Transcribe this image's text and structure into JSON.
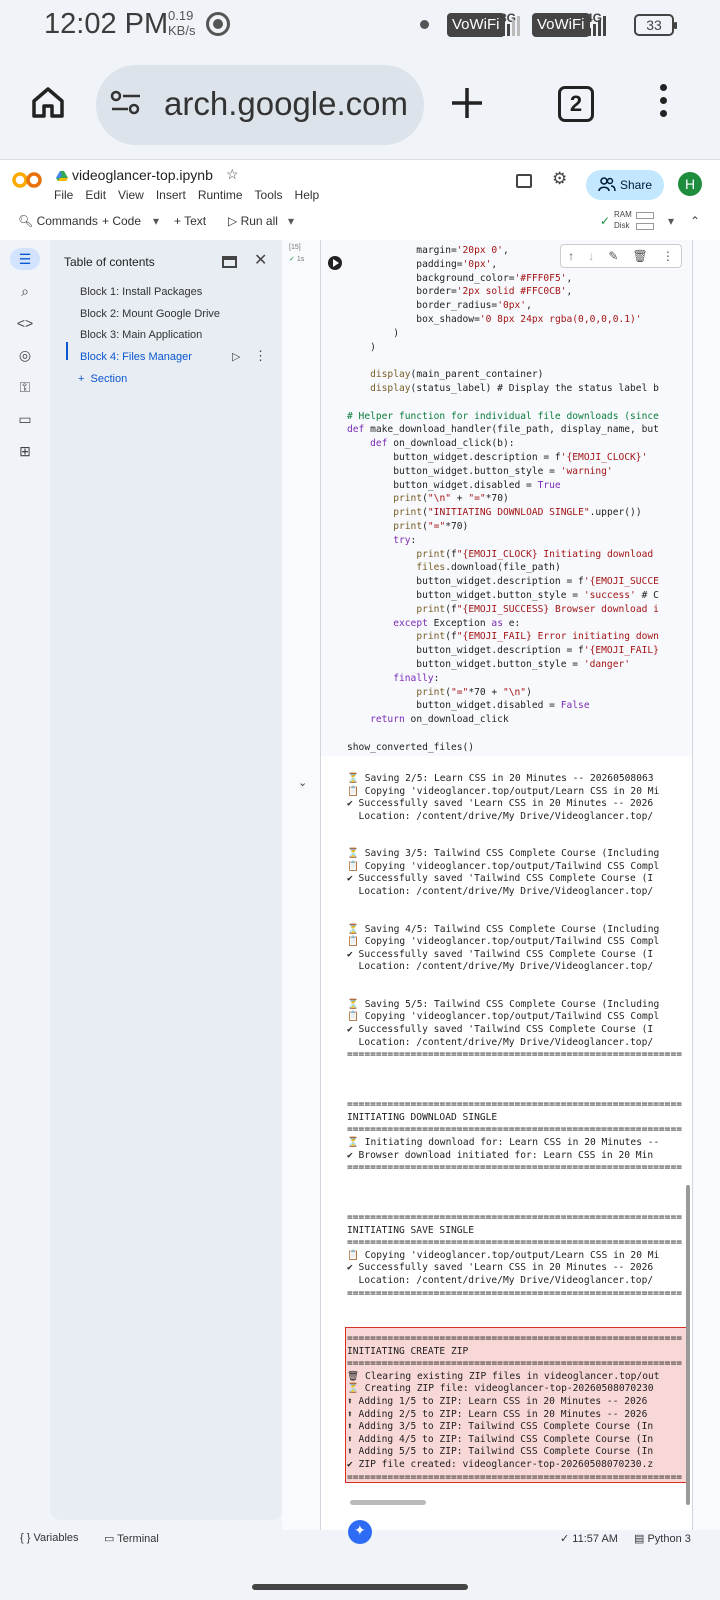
{
  "status": {
    "time": "12:02 PM",
    "speed_value": "0.19",
    "speed_unit": "KB/s",
    "vowifi1": "VoWiFi",
    "net1": "3G",
    "vowifi2": "VoWiFi",
    "net2": "4G",
    "battery": "33"
  },
  "browser": {
    "url": "arch.google.com",
    "tab_count": "2"
  },
  "colab": {
    "title": "videoglancer-top.ipynb",
    "menu": [
      "File",
      "Edit",
      "View",
      "Insert",
      "Runtime",
      "Tools",
      "Help"
    ],
    "share": "Share",
    "avatar": "H",
    "toolbar": {
      "commands": "Commands",
      "code": "+ Code",
      "text": "+ Text",
      "run_all": "Run all",
      "ram": "RAM",
      "disk": "Disk"
    }
  },
  "toc": {
    "title": "Table of contents",
    "items": [
      "Block 1: Install Packages",
      "Block 2: Mount Google Drive",
      "Block 3: Main Application",
      "Block 4: Files Manager"
    ],
    "add_section": "Section"
  },
  "cell": {
    "exec_count": "[15]",
    "exec_time": "1s"
  },
  "code_lines": [
    "            margin='20px 0',",
    "            padding='0px',",
    "            background_color='#FFF0F5',",
    "            border='2px solid #FFC0CB',",
    "            border_radius='0px',",
    "            box_shadow='0 8px 24px rgba(0,0,0,0.1)'",
    "        )",
    "    )",
    "",
    "    display(main_parent_container)",
    "    display(status_label) # Display the status label b",
    "",
    "# Helper function for individual file downloads (since",
    "def make_download_handler(file_path, display_name, but",
    "    def on_download_click(b):",
    "        button_widget.description = f'{EMOJI_CLOCK}'",
    "        button_widget.button_style = 'warning'",
    "        button_widget.disabled = True",
    "        print(\"\\n\" + \"=\"*70)",
    "        print(\"INITIATING DOWNLOAD SINGLE\".upper())",
    "        print(\"=\"*70)",
    "        try:",
    "            print(f\"{EMOJI_CLOCK} Initiating download",
    "            files.download(file_path)",
    "            button_widget.description = f'{EMOJI_SUCCE",
    "            button_widget.button_style = 'success' # C",
    "            print(f\"{EMOJI_SUCCESS} Browser download i",
    "        except Exception as e:",
    "            print(f\"{EMOJI_FAIL} Error initiating down",
    "            button_widget.description = f'{EMOJI_FAIL}",
    "            button_widget.button_style = 'danger'",
    "        finally:",
    "            print(\"=\"*70 + \"\\n\")",
    "            button_widget.disabled = False",
    "    return on_download_click",
    "",
    "show_converted_files()"
  ],
  "output_lines": [
    "⏳ Saving 2/5: Learn CSS in 20 Minutes -- 20260508063",
    "📋 Copying 'videoglancer.top/output/Learn CSS in 20 Mi",
    "✔ Successfully saved 'Learn CSS in 20 Minutes -- 2026",
    "  Location: /content/drive/My Drive/Videoglancer.top/",
    "",
    "",
    "⏳ Saving 3/5: Tailwind CSS Complete Course (Including",
    "📋 Copying 'videoglancer.top/output/Tailwind CSS Compl",
    "✔ Successfully saved 'Tailwind CSS Complete Course (I",
    "  Location: /content/drive/My Drive/Videoglancer.top/",
    "",
    "",
    "⏳ Saving 4/5: Tailwind CSS Complete Course (Including",
    "📋 Copying 'videoglancer.top/output/Tailwind CSS Compl",
    "✔ Successfully saved 'Tailwind CSS Complete Course (I",
    "  Location: /content/drive/My Drive/Videoglancer.top/",
    "",
    "",
    "⏳ Saving 5/5: Tailwind CSS Complete Course (Including",
    "📋 Copying 'videoglancer.top/output/Tailwind CSS Compl",
    "✔ Successfully saved 'Tailwind CSS Complete Course (I",
    "  Location: /content/drive/My Drive/Videoglancer.top/",
    "==========================================================",
    "",
    "",
    "",
    "==========================================================",
    "INITIATING DOWNLOAD SINGLE",
    "==========================================================",
    "⏳ Initiating download for: Learn CSS in 20 Minutes --",
    "✔ Browser download initiated for: Learn CSS in 20 Min",
    "==========================================================",
    "",
    "",
    "",
    "==========================================================",
    "INITIATING SAVE SINGLE",
    "==========================================================",
    "📋 Copying 'videoglancer.top/output/Learn CSS in 20 Mi",
    "✔ Successfully saved 'Learn CSS in 20 Minutes -- 2026",
    "  Location: /content/drive/My Drive/Videoglancer.top/",
    "=========================================================="
  ],
  "zip_lines": [
    "==========================================================",
    "INITIATING CREATE ZIP",
    "==========================================================",
    "🗑 Clearing existing ZIP files in videoglancer.top/out",
    "⏳ Creating ZIP file: videoglancer-top-20260508070230",
    "⬆ Adding 1/5 to ZIP: Learn CSS in 20 Minutes -- 2026",
    "⬆ Adding 2/5 to ZIP: Learn CSS in 20 Minutes -- 2026",
    "⬆ Adding 3/5 to ZIP: Tailwind CSS Complete Course (In",
    "⬆ Adding 4/5 to ZIP: Tailwind CSS Complete Course (In",
    "⬆ Adding 5/5 to ZIP: Tailwind CSS Complete Course (In",
    "✔ ZIP file created: videoglancer-top-20260508070230.z",
    "=========================================================="
  ],
  "bottom": {
    "variables": "Variables",
    "terminal": "Terminal",
    "time": "11:57 AM",
    "runtime": "Python 3"
  }
}
